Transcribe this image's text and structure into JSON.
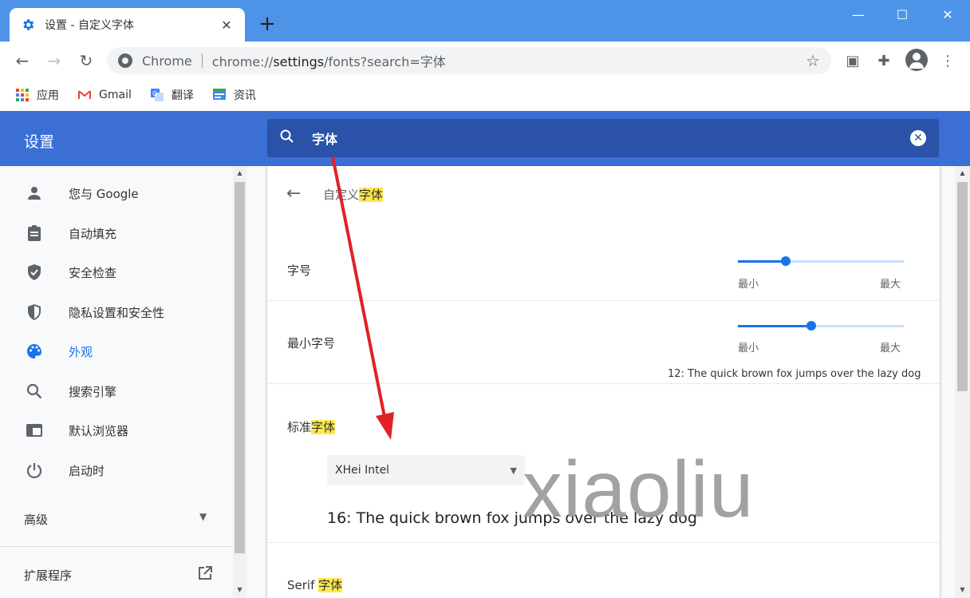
{
  "tab": {
    "title": "设置 - 自定义字体",
    "close": "✕"
  },
  "newtab": "+",
  "window": {
    "minimize": "—",
    "maximize": "☐",
    "close": "✕"
  },
  "omnibox": {
    "scheme": "Chrome",
    "url_prefix": "chrome://",
    "url_host": "settings",
    "url_path": "/fonts?search=字体"
  },
  "bookmarks": [
    {
      "label": "应用",
      "icon": "apps-grid-icon"
    },
    {
      "label": "Gmail",
      "icon": "gmail-icon"
    },
    {
      "label": "翻译",
      "icon": "translate-icon"
    },
    {
      "label": "资讯",
      "icon": "news-icon"
    }
  ],
  "settings_header": {
    "title": "设置",
    "search_query": "字体"
  },
  "sidebar": {
    "items": [
      {
        "label": "您与 Google",
        "icon": "person-icon"
      },
      {
        "label": "自动填充",
        "icon": "clipboard-icon"
      },
      {
        "label": "安全检查",
        "icon": "shield-check-icon"
      },
      {
        "label": "隐私设置和安全性",
        "icon": "shield-icon"
      },
      {
        "label": "外观",
        "icon": "palette-icon",
        "active": true
      },
      {
        "label": "搜索引擎",
        "icon": "search-icon"
      },
      {
        "label": "默认浏览器",
        "icon": "browser-icon"
      },
      {
        "label": "启动时",
        "icon": "power-icon"
      }
    ],
    "advanced": "高级",
    "extensions": "扩展程序"
  },
  "card": {
    "title_prefix": "自定义",
    "title_highlight": "字体",
    "font_size": {
      "label": "字号",
      "min": "最小",
      "max": "最大",
      "value": 0.29
    },
    "min_font_size": {
      "label": "最小字号",
      "min": "最小",
      "max": "最大",
      "value": 0.44
    },
    "sample_12": "12: The quick brown fox jumps over the lazy dog",
    "standard_font": {
      "label_prefix": "标准",
      "label_highlight": "字体",
      "selected": "XHei Intel"
    },
    "sample_16": "16: The quick brown fox jumps over the lazy dog",
    "serif_font": {
      "label_prefix": "Serif ",
      "label_highlight": "字体"
    }
  },
  "watermark": "xiaoliu",
  "colors": {
    "header": "#3b6fd4",
    "search": "#2a52a8",
    "accent": "#1a73e8",
    "highlight": "#fde84b",
    "arrow": "#e32027"
  }
}
